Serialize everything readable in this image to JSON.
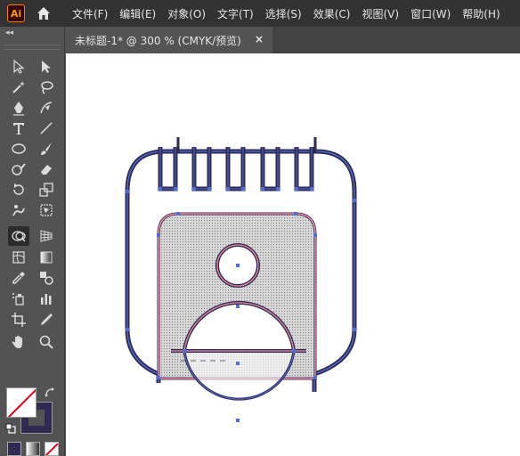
{
  "app": {
    "logo_text": "Ai",
    "home_icon": "home-icon"
  },
  "menu": {
    "items": [
      {
        "label": "文件(F)"
      },
      {
        "label": "编辑(E)"
      },
      {
        "label": "对象(O)"
      },
      {
        "label": "文字(T)"
      },
      {
        "label": "选择(S)"
      },
      {
        "label": "效果(C)"
      },
      {
        "label": "视图(V)"
      },
      {
        "label": "窗口(W)"
      },
      {
        "label": "帮助(H)"
      }
    ]
  },
  "document_tab": {
    "title": "未标题-1* @ 300 % (CMYK/预览)",
    "close_label": "×"
  },
  "toolbar": {
    "collapse_label": "◂◂",
    "tools": [
      "selection-tool",
      "direct-selection-tool",
      "magic-wand-tool",
      "lasso-tool",
      "pen-tool",
      "curvature-tool",
      "type-tool",
      "line-segment-tool",
      "ellipse-tool",
      "paintbrush-tool",
      "shaper-tool",
      "eraser-tool",
      "rotate-tool",
      "scale-tool",
      "puppet-warp-tool",
      "free-transform-tool",
      "shape-builder-tool",
      "perspective-grid-tool",
      "mesh-tool",
      "gradient-tool",
      "eyedropper-tool",
      "blend-tool",
      "symbol-sprayer-tool",
      "column-graph-tool",
      "artboard-tool",
      "slice-tool",
      "hand-tool",
      "zoom-tool"
    ],
    "active_tool": "shape-builder-tool"
  },
  "colors": {
    "fill": "#ffffff",
    "stroke": "#2e2a52",
    "selection_blue": "#4f6fd8",
    "artwork_pink": "#f08aa3",
    "artwork_navy": "#2e2a52",
    "accent_orange": "#ff9a00"
  }
}
